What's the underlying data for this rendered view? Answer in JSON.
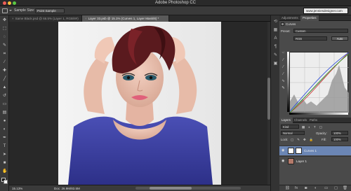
{
  "window": {
    "title": "Adobe Photoshop CC"
  },
  "options_bar": {
    "sample_size_label": "Sample Size:",
    "sample_size_value": "Point Sample",
    "url_text": "www.jenniesdesigner.com"
  },
  "document_tabs": [
    {
      "label": "Same Black.psd @ 66.5% (Layer 1, RGB/8#)",
      "active": false
    },
    {
      "label": "Layer 33.psb @ 15.1% (Curves 1, Layer Mask/8) *",
      "active": true
    }
  ],
  "status_bar": {
    "zoom": "15.13%",
    "doc_info": "Doc: 26.9M/83.5M"
  },
  "adjustments_panel": {
    "tabs": [
      "Adjustments",
      "Properties"
    ],
    "header": "Curves",
    "preset_label": "Preset:",
    "preset_value": "Custom",
    "channel_value": "RGB",
    "auto_label": "Auto"
  },
  "layers_panel": {
    "tabs": [
      "Layers",
      "Channels",
      "Paths"
    ],
    "kind_label": "Kind",
    "blend_mode": "Normal",
    "opacity_label": "Opacity:",
    "opacity_value": "100%",
    "lock_label": "Lock:",
    "fill_label": "Fill:",
    "fill_value": "100%",
    "layers": [
      {
        "name": "Curves 1",
        "selected": true
      },
      {
        "name": "Layer 1",
        "selected": false
      }
    ]
  },
  "colors": {
    "ui_dark": "#2b2b2b",
    "ui_mid": "#3a3a3a",
    "panel": "#4a4a4a",
    "selection": "#6b86b5",
    "shirt": "#3a3ea0",
    "hair": "#5a1a1e"
  }
}
